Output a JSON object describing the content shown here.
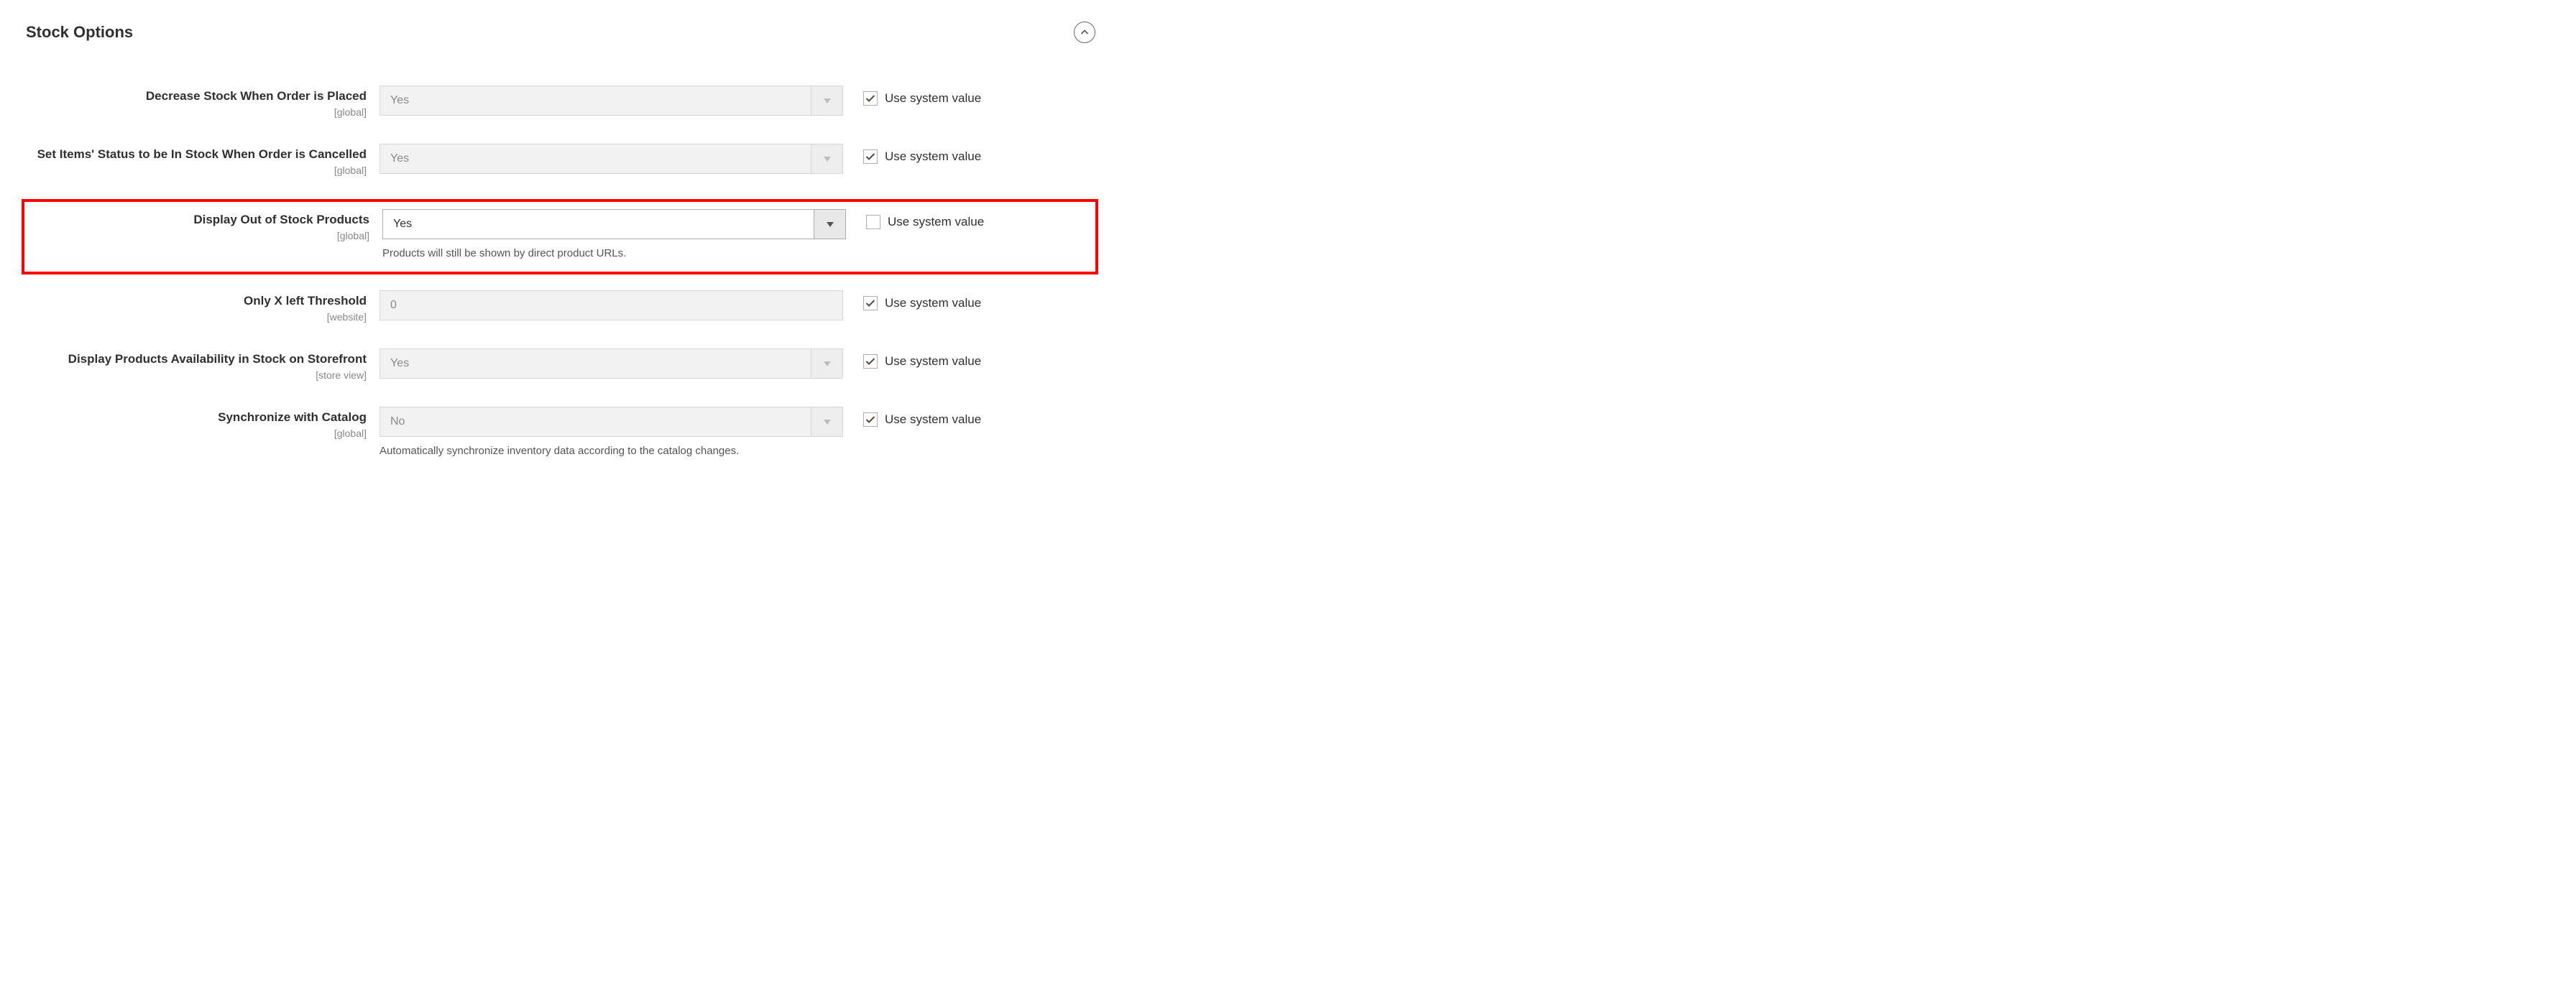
{
  "section": {
    "title": "Stock Options"
  },
  "common": {
    "use_system_value": "Use system value",
    "scope_global": "[global]",
    "scope_website": "[website]",
    "scope_store_view": "[store view]"
  },
  "fields": {
    "decrease_stock": {
      "label": "Decrease Stock When Order is Placed",
      "value": "Yes",
      "use_system": true
    },
    "set_in_stock_on_cancel": {
      "label": "Set Items' Status to be In Stock When Order is Cancelled",
      "value": "Yes",
      "use_system": true
    },
    "display_out_of_stock": {
      "label": "Display Out of Stock Products",
      "value": "Yes",
      "helper": "Products will still be shown by direct product URLs.",
      "use_system": false
    },
    "only_x_left": {
      "label": "Only X left Threshold",
      "value": "0",
      "use_system": true
    },
    "display_availability": {
      "label": "Display Products Availability in Stock on Storefront",
      "value": "Yes",
      "use_system": true
    },
    "sync_catalog": {
      "label": "Synchronize with Catalog",
      "value": "No",
      "helper": "Automatically synchronize inventory data according to the catalog changes.",
      "use_system": true
    }
  }
}
